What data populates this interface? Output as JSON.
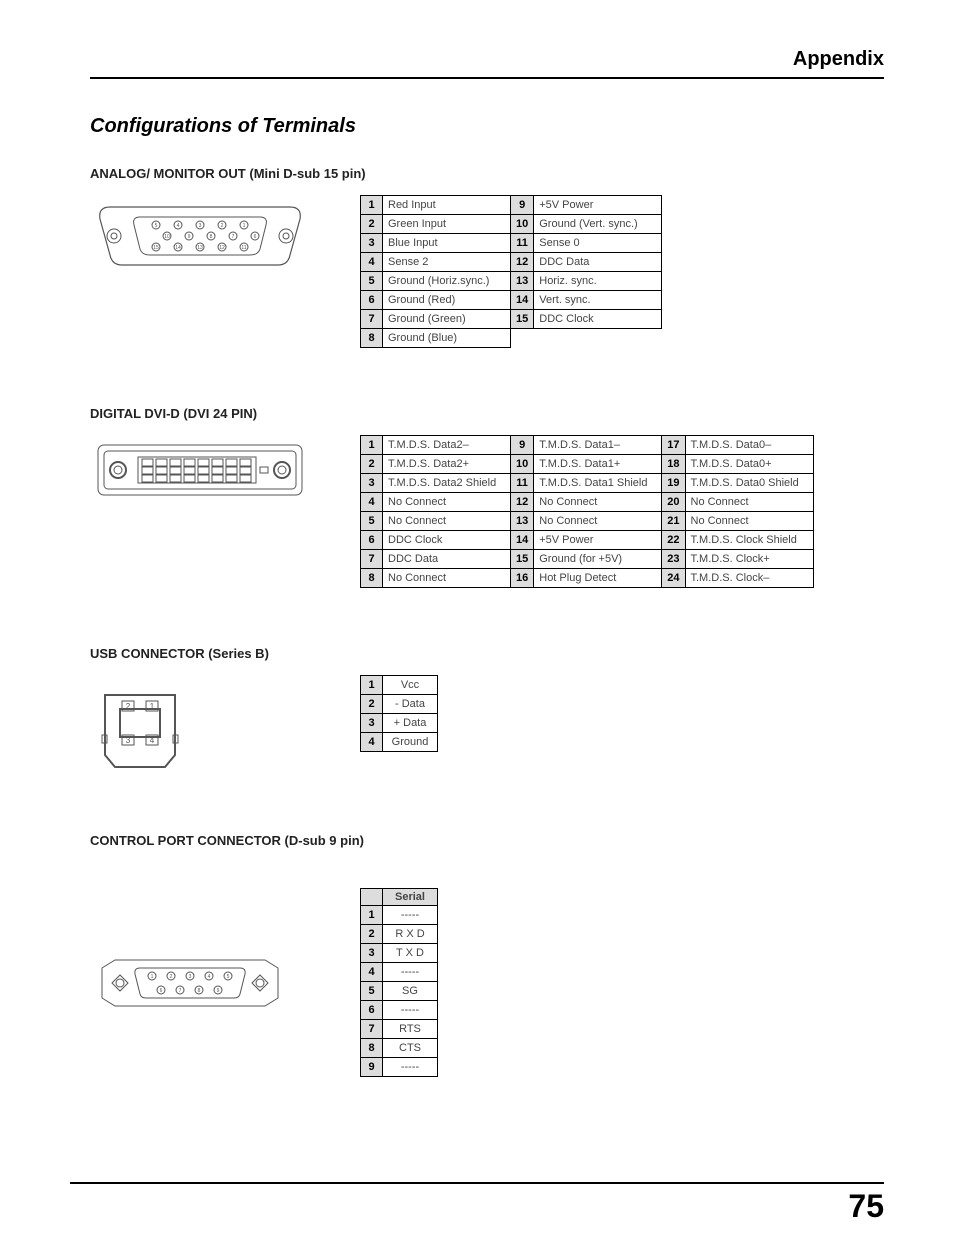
{
  "header": "Appendix",
  "title": "Configurations of Terminals",
  "page_number": "75",
  "sections": {
    "analog": {
      "label": "ANALOG/ MONITOR OUT (Mini D-sub 15 pin)",
      "pins_a": [
        {
          "n": "1",
          "v": "Red Input"
        },
        {
          "n": "2",
          "v": "Green Input"
        },
        {
          "n": "3",
          "v": "Blue Input"
        },
        {
          "n": "4",
          "v": "Sense 2"
        },
        {
          "n": "5",
          "v": "Ground (Horiz.sync.)"
        },
        {
          "n": "6",
          "v": "Ground (Red)"
        },
        {
          "n": "7",
          "v": "Ground (Green)"
        },
        {
          "n": "8",
          "v": "Ground (Blue)"
        }
      ],
      "pins_b": [
        {
          "n": "9",
          "v": "+5V Power"
        },
        {
          "n": "10",
          "v": "Ground (Vert. sync.)"
        },
        {
          "n": "11",
          "v": "Sense 0"
        },
        {
          "n": "12",
          "v": "DDC Data"
        },
        {
          "n": "13",
          "v": "Horiz. sync."
        },
        {
          "n": "14",
          "v": "Vert. sync."
        },
        {
          "n": "15",
          "v": "DDC Clock"
        }
      ]
    },
    "dvi": {
      "label": "DIGITAL DVI-D (DVI 24 PIN)",
      "pins_a": [
        {
          "n": "1",
          "v": "T.M.D.S. Data2–"
        },
        {
          "n": "2",
          "v": "T.M.D.S. Data2+"
        },
        {
          "n": "3",
          "v": "T.M.D.S. Data2 Shield"
        },
        {
          "n": "4",
          "v": "No Connect"
        },
        {
          "n": "5",
          "v": "No Connect"
        },
        {
          "n": "6",
          "v": "DDC Clock"
        },
        {
          "n": "7",
          "v": "DDC Data"
        },
        {
          "n": "8",
          "v": "No Connect"
        }
      ],
      "pins_b": [
        {
          "n": "9",
          "v": "T.M.D.S. Data1–"
        },
        {
          "n": "10",
          "v": "T.M.D.S. Data1+"
        },
        {
          "n": "11",
          "v": "T.M.D.S. Data1 Shield"
        },
        {
          "n": "12",
          "v": "No Connect"
        },
        {
          "n": "13",
          "v": "No Connect"
        },
        {
          "n": "14",
          "v": "+5V Power"
        },
        {
          "n": "15",
          "v": "Ground (for +5V)"
        },
        {
          "n": "16",
          "v": "Hot Plug Detect"
        }
      ],
      "pins_c": [
        {
          "n": "17",
          "v": "T.M.D.S. Data0–"
        },
        {
          "n": "18",
          "v": "T.M.D.S. Data0+"
        },
        {
          "n": "19",
          "v": "T.M.D.S. Data0 Shield"
        },
        {
          "n": "20",
          "v": "No Connect"
        },
        {
          "n": "21",
          "v": "No Connect"
        },
        {
          "n": "22",
          "v": "T.M.D.S. Clock Shield"
        },
        {
          "n": "23",
          "v": "T.M.D.S. Clock+"
        },
        {
          "n": "24",
          "v": "T.M.D.S. Clock–"
        }
      ]
    },
    "usb": {
      "label": "USB CONNECTOR (Series B)",
      "pins": [
        {
          "n": "1",
          "v": "Vcc"
        },
        {
          "n": "2",
          "v": "- Data"
        },
        {
          "n": "3",
          "v": "+ Data"
        },
        {
          "n": "4",
          "v": "Ground"
        }
      ]
    },
    "serial": {
      "label": "CONTROL PORT CONNECTOR (D-sub 9 pin)",
      "header": "Serial",
      "pins": [
        {
          "n": "1",
          "v": "-----"
        },
        {
          "n": "2",
          "v": "R X D"
        },
        {
          "n": "3",
          "v": "T X D"
        },
        {
          "n": "4",
          "v": "-----"
        },
        {
          "n": "5",
          "v": "SG"
        },
        {
          "n": "6",
          "v": "-----"
        },
        {
          "n": "7",
          "v": "RTS"
        },
        {
          "n": "8",
          "v": "CTS"
        },
        {
          "n": "9",
          "v": "-----"
        }
      ]
    }
  }
}
